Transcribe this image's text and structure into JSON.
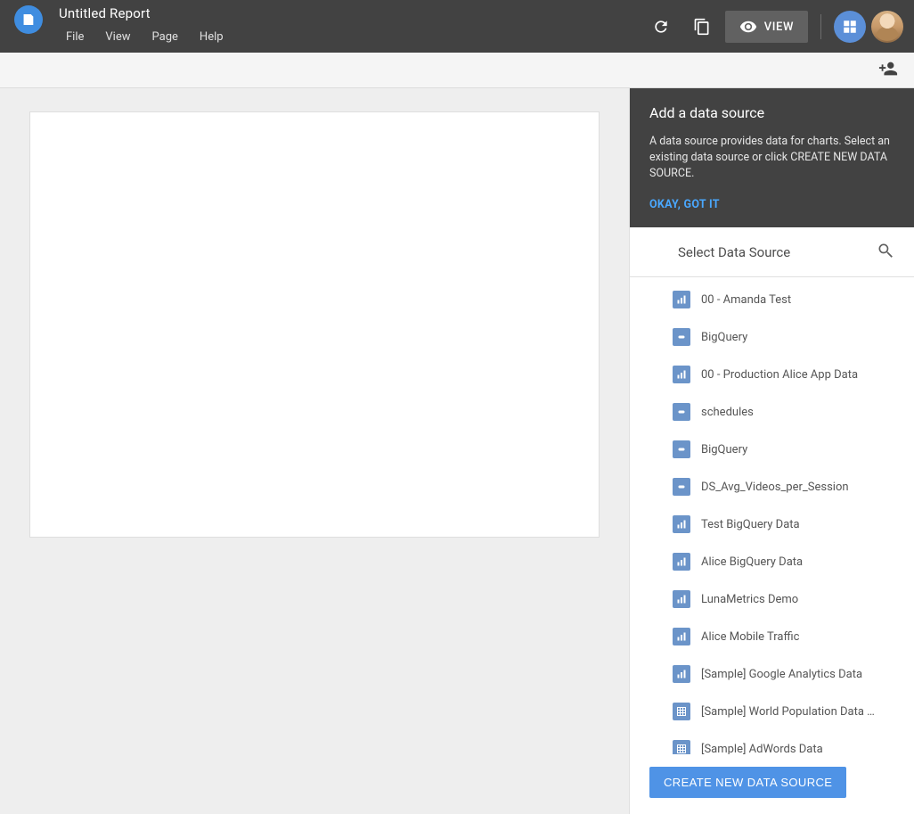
{
  "header": {
    "title": "Untitled Report",
    "menu": {
      "file": "File",
      "view": "View",
      "page": "Page",
      "help": "Help"
    },
    "view_btn": "VIEW"
  },
  "panel": {
    "heading": "Add a data source",
    "description": "A data source provides data for charts. Select an existing data source or click CREATE NEW DATA SOURCE.",
    "okay": "OKAY, GOT IT",
    "select_title": "Select Data Source",
    "create_btn": "CREATE NEW DATA SOURCE"
  },
  "data_sources": [
    {
      "label": "00 - Amanda Test",
      "type": "analytics"
    },
    {
      "label": "BigQuery",
      "type": "bq"
    },
    {
      "label": "00 - Production Alice App Data",
      "type": "analytics"
    },
    {
      "label": "schedules",
      "type": "bq"
    },
    {
      "label": "BigQuery",
      "type": "bq"
    },
    {
      "label": "DS_Avg_Videos_per_Session",
      "type": "bq"
    },
    {
      "label": "Test BigQuery Data",
      "type": "analytics"
    },
    {
      "label": "Alice BigQuery Data",
      "type": "analytics"
    },
    {
      "label": "LunaMetrics Demo",
      "type": "analytics"
    },
    {
      "label": "Alice Mobile Traffic",
      "type": "analytics"
    },
    {
      "label": "[Sample] Google Analytics Data",
      "type": "analytics"
    },
    {
      "label": "[Sample] World Population Data 2...",
      "type": "sheets"
    },
    {
      "label": "[Sample] AdWords Data",
      "type": "sheets"
    }
  ]
}
